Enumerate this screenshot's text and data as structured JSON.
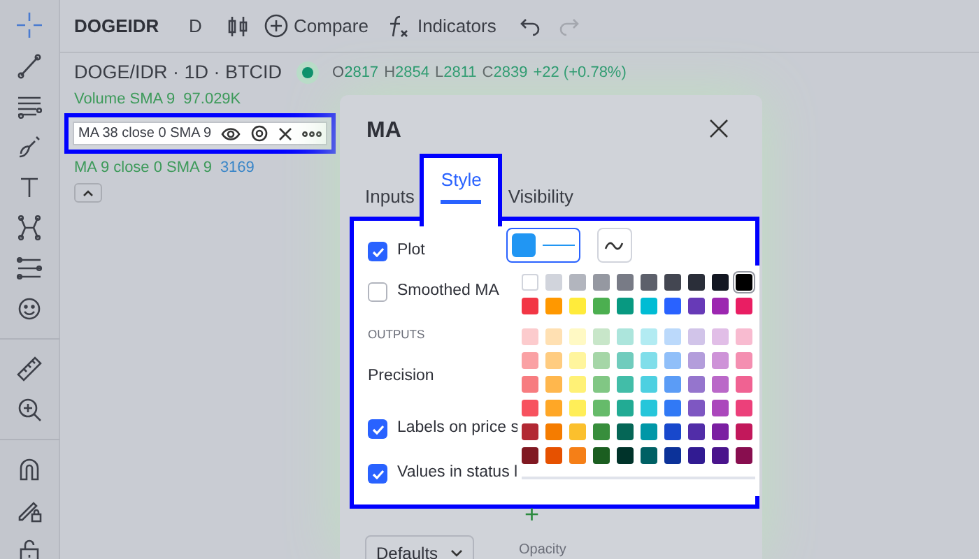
{
  "top_bar": {
    "symbol": "DOGEIDR",
    "interval": "D",
    "compare": "Compare",
    "indicators": "Indicators"
  },
  "legend": {
    "title": "DOGE/IDR · 1D · BTCID",
    "ohlc": [
      {
        "label": "O",
        "value": "2817"
      },
      {
        "label": "H",
        "value": "2854"
      },
      {
        "label": "L",
        "value": "2811"
      },
      {
        "label": "C",
        "value": "2839"
      }
    ],
    "change": "+22 (+0.78%)",
    "studies": [
      {
        "kind": "plain",
        "name": "Volume SMA 9",
        "value": "97.029K"
      },
      {
        "kind": "hovered",
        "name": "MA 38 close 0 SMA 9"
      },
      {
        "kind": "plain",
        "name": "MA 9 close 0 SMA 9",
        "value": "3169"
      }
    ]
  },
  "dialog": {
    "title": "MA",
    "tabs": [
      {
        "label": "Inputs",
        "selected": false
      },
      {
        "label": "Style",
        "selected": true
      },
      {
        "label": "Visibility",
        "selected": false
      }
    ],
    "rows": [
      {
        "kind": "checkbox",
        "label": "Plot",
        "checked": true
      },
      {
        "kind": "checkbox",
        "label": "Smoothed MA",
        "checked": false
      },
      {
        "kind": "header",
        "label": "OUTPUTS"
      },
      {
        "kind": "label",
        "label": "Precision"
      },
      {
        "kind": "checkbox",
        "label": "Labels on price s",
        "checked": true
      },
      {
        "kind": "checkbox",
        "label": "Values in status l",
        "checked": true
      }
    ],
    "swatch_rows": [
      [
        {
          "color": "#ffffff",
          "selected": false
        },
        {
          "color": "#d1d4dc",
          "selected": false
        },
        {
          "color": "#b2b5be",
          "selected": false
        },
        {
          "color": "#9598a1",
          "selected": false
        },
        {
          "color": "#787b86",
          "selected": false
        },
        {
          "color": "#5d606b",
          "selected": false
        },
        {
          "color": "#434651",
          "selected": false
        },
        {
          "color": "#2a2e39",
          "selected": false
        },
        {
          "color": "#131722",
          "selected": false
        },
        {
          "color": "#000000",
          "selected": true
        }
      ],
      [
        {
          "color": "#f23645",
          "selected": false
        },
        {
          "color": "#ff9800",
          "selected": false
        },
        {
          "color": "#ffeb3b",
          "selected": false
        },
        {
          "color": "#4caf50",
          "selected": false
        },
        {
          "color": "#089981",
          "selected": false
        },
        {
          "color": "#00bcd4",
          "selected": false
        },
        {
          "color": "#2962ff",
          "selected": false
        },
        {
          "color": "#673ab7",
          "selected": false
        },
        {
          "color": "#9c27b0",
          "selected": false
        },
        {
          "color": "#e91e63",
          "selected": false
        }
      ],
      [
        {
          "color": "#fccbcd",
          "selected": false
        },
        {
          "color": "#ffe0b2",
          "selected": false
        },
        {
          "color": "#fff9c4",
          "selected": false
        },
        {
          "color": "#c8e6c9",
          "selected": false
        },
        {
          "color": "#ace5dc",
          "selected": false
        },
        {
          "color": "#b2ebf2",
          "selected": false
        },
        {
          "color": "#bbd9fb",
          "selected": false
        },
        {
          "color": "#d1c4e9",
          "selected": false
        },
        {
          "color": "#e1bee7",
          "selected": false
        },
        {
          "color": "#f8bbd0",
          "selected": false
        }
      ],
      [
        {
          "color": "#faa1a4",
          "selected": false
        },
        {
          "color": "#ffcc80",
          "selected": false
        },
        {
          "color": "#fff59d",
          "selected": false
        },
        {
          "color": "#a5d6a7",
          "selected": false
        },
        {
          "color": "#70ccbd",
          "selected": false
        },
        {
          "color": "#80deea",
          "selected": false
        },
        {
          "color": "#90bff9",
          "selected": false
        },
        {
          "color": "#b39ddb",
          "selected": false
        },
        {
          "color": "#ce93d8",
          "selected": false
        },
        {
          "color": "#f48fb1",
          "selected": false
        }
      ],
      [
        {
          "color": "#f77c80",
          "selected": false
        },
        {
          "color": "#ffb74d",
          "selected": false
        },
        {
          "color": "#fff176",
          "selected": false
        },
        {
          "color": "#81c784",
          "selected": false
        },
        {
          "color": "#42bda8",
          "selected": false
        },
        {
          "color": "#4dd0e1",
          "selected": false
        },
        {
          "color": "#5b9cf6",
          "selected": false
        },
        {
          "color": "#9575cd",
          "selected": false
        },
        {
          "color": "#ba68c8",
          "selected": false
        },
        {
          "color": "#f06292",
          "selected": false
        }
      ],
      [
        {
          "color": "#f7525f",
          "selected": false
        },
        {
          "color": "#ffa726",
          "selected": false
        },
        {
          "color": "#ffee58",
          "selected": false
        },
        {
          "color": "#66bb6a",
          "selected": false
        },
        {
          "color": "#22ab94",
          "selected": false
        },
        {
          "color": "#26c6da",
          "selected": false
        },
        {
          "color": "#3179f5",
          "selected": false
        },
        {
          "color": "#7e57c2",
          "selected": false
        },
        {
          "color": "#ab47bc",
          "selected": false
        },
        {
          "color": "#ec407a",
          "selected": false
        }
      ],
      [
        {
          "color": "#b22833",
          "selected": false
        },
        {
          "color": "#f57c00",
          "selected": false
        },
        {
          "color": "#fbc02d",
          "selected": false
        },
        {
          "color": "#388e3c",
          "selected": false
        },
        {
          "color": "#056656",
          "selected": false
        },
        {
          "color": "#0097a7",
          "selected": false
        },
        {
          "color": "#1848cc",
          "selected": false
        },
        {
          "color": "#512da8",
          "selected": false
        },
        {
          "color": "#7b1fa2",
          "selected": false
        },
        {
          "color": "#c2185b",
          "selected": false
        }
      ],
      [
        {
          "color": "#801922",
          "selected": false
        },
        {
          "color": "#e65100",
          "selected": false
        },
        {
          "color": "#f57f17",
          "selected": false
        },
        {
          "color": "#1b5e20",
          "selected": false
        },
        {
          "color": "#00332a",
          "selected": false
        },
        {
          "color": "#006064",
          "selected": false
        },
        {
          "color": "#0c3299",
          "selected": false
        },
        {
          "color": "#311b92",
          "selected": false
        },
        {
          "color": "#4a148c",
          "selected": false
        },
        {
          "color": "#880e4f",
          "selected": false
        }
      ]
    ],
    "add_symbol": "+",
    "opacity_label": "Opacity",
    "defaults": "Defaults"
  }
}
